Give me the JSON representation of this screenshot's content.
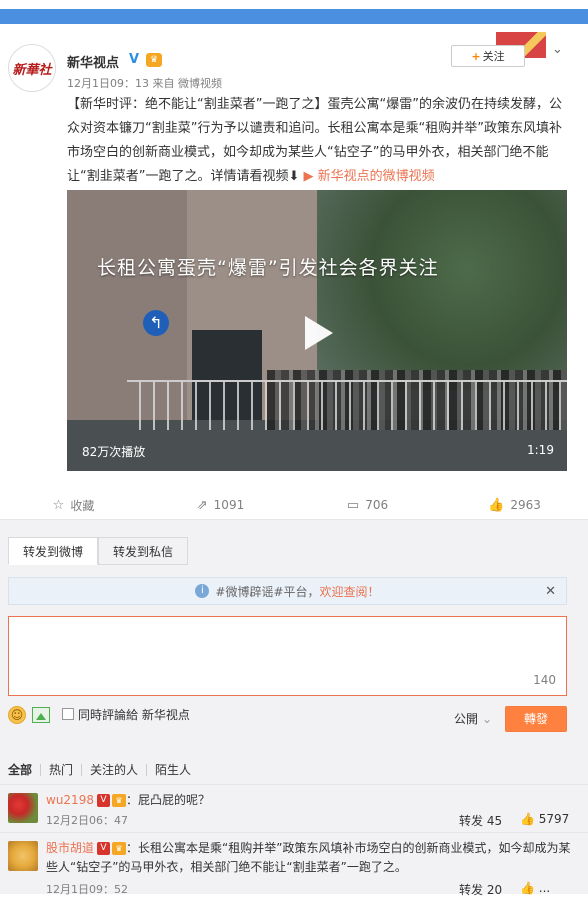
{
  "post": {
    "author": "新华视点",
    "verify_icon": "V",
    "meta": "12月1日09：13 来自 微博视频",
    "follow_label": "关注",
    "text_main": "【新华时评：绝不能让“割韭菜者”一跑了之】蛋壳公寓“爆雷”的余波仍在持续发酵，公众对资本镰刀“割韭菜”行为予以谴责和追问。长租公寓本是乘“租购并举”政策东风填补市场空白的创新商业模式，如今却成为某些人“钻空子”的马甲外衣，相关部门绝不能让“割韭菜者”一跑了之。详情请看视频⬇",
    "text_link": "新华视点的微博视频",
    "video": {
      "title": "长租公寓蛋壳“爆雷”引发社会各界关注",
      "views": "82万次播放",
      "duration": "1:19"
    },
    "actions": {
      "favorite": "收藏",
      "repost": "1091",
      "comment": "706",
      "like": "2963"
    }
  },
  "repost_panel": {
    "tab_weibo": "转发到微博",
    "tab_private": "转发到私信",
    "notice_prefix": "#微博辟谣#平台，",
    "notice_link": "欢迎查阅！",
    "char_count": "140",
    "also_comment": "同時評論給 新华视点",
    "visibility": "公開",
    "submit": "轉發"
  },
  "comment_tabs": [
    "全部",
    "热门",
    "关注的人",
    "陌生人"
  ],
  "comments": [
    {
      "user": "wu2198",
      "text": "：屁凸屁的呢？",
      "time": "12月2日06：47",
      "forward": "转发 45",
      "likes": "5797"
    },
    {
      "user": "股市胡道",
      "text": "：长租公寓本是乘“租购并举”政策东风填补市场空白的创新商业模式，如今却成为某些人“钻空子”的马甲外衣，相关部门绝不能让“割韭菜者”一跑了之。",
      "time": "12月1日09：52",
      "forward": "转发 20",
      "likes": "..."
    }
  ],
  "colors": {
    "accent": "#eb7350",
    "topbar": "#4a8fe0",
    "submit": "#ff8140"
  }
}
